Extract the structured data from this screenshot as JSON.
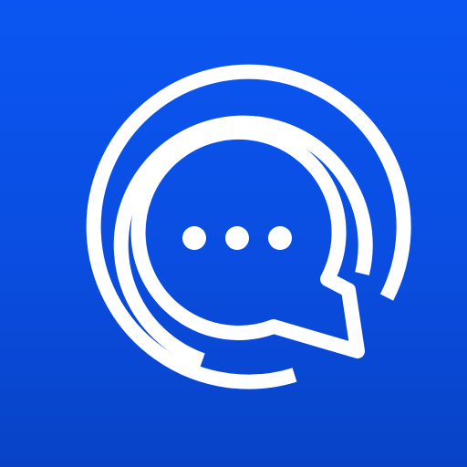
{
  "icon": {
    "name": "chat-app-icon",
    "depicts": "speech-bubble-icon",
    "colors": {
      "background": "#0a4de0",
      "foreground": "#ffffff"
    }
  }
}
